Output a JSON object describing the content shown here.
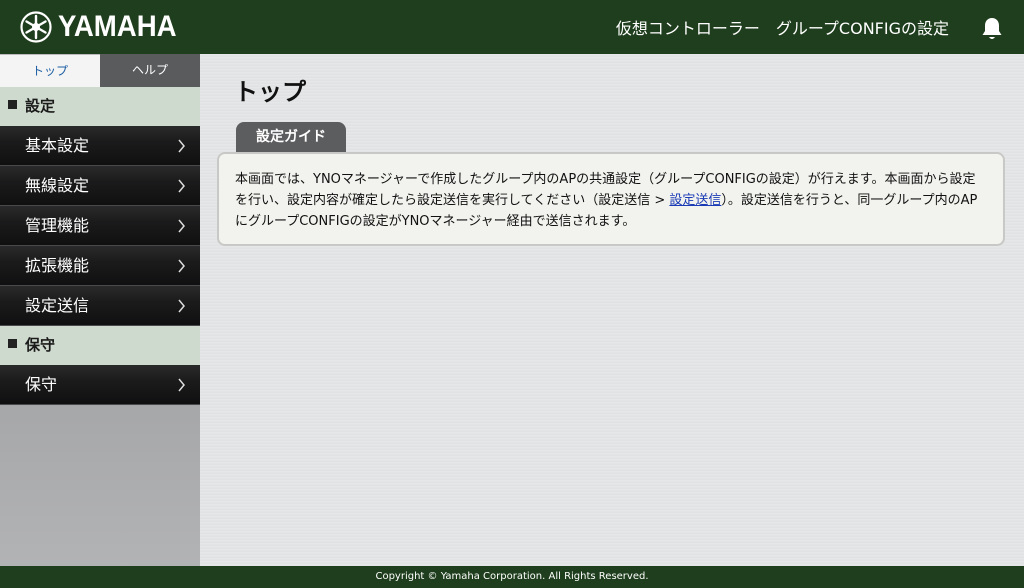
{
  "brand": {
    "logo_text": "YAMAHA"
  },
  "header": {
    "title": "仮想コントローラー　グループCONFIGの設定"
  },
  "sidebar": {
    "tabs": [
      {
        "label": "トップ",
        "active": true
      },
      {
        "label": "ヘルプ",
        "active": false
      }
    ],
    "sections": [
      {
        "label": "設定",
        "items": [
          {
            "label": "基本設定"
          },
          {
            "label": "無線設定"
          },
          {
            "label": "管理機能"
          },
          {
            "label": "拡張機能"
          },
          {
            "label": "設定送信"
          }
        ]
      },
      {
        "label": "保守",
        "items": [
          {
            "label": "保守"
          }
        ]
      }
    ]
  },
  "main": {
    "title": "トップ",
    "guide_tab": "設定ガイド",
    "guide_text_1": "本画面では、YNOマネージャーで作成したグループ内のAPの共通設定（グループCONFIGの設定）が行えます。本画面から設定を行い、設定内容が確定したら設定送信を実行してください（設定送信 > ",
    "guide_link": "設定送信",
    "guide_text_2": "）。設定送信を行うと、同一グループ内のAPにグループCONFIGの設定がYNOマネージャー経由で送信されます。"
  },
  "footer": {
    "copyright": "Copyright © Yamaha Corporation. All Rights Reserved."
  },
  "colors": {
    "header_bg": "#1f3e1d",
    "section_bg": "#cfdacf",
    "link": "#1a3bb5"
  }
}
